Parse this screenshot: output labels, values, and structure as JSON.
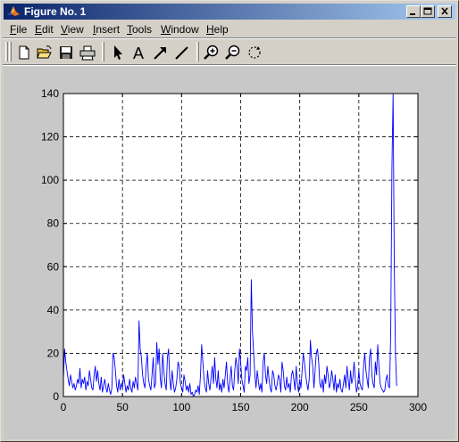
{
  "window": {
    "title": "Figure No. 1",
    "titlebar_gradient": [
      "#0a246a",
      "#a6caf0"
    ]
  },
  "menu": [
    "File",
    "Edit",
    "View",
    "Insert",
    "Tools",
    "Window",
    "Help"
  ],
  "menu_underlines": [
    "F",
    "E",
    "V",
    "I",
    "T",
    "W",
    "H"
  ],
  "toolbar": {
    "tools": [
      "new-file-icon",
      "open-folder-icon",
      "save-icon",
      "print-icon",
      "arrow-select-icon",
      "text-insert-icon",
      "arrow-insert-icon",
      "line-insert-icon",
      "zoom-in-icon",
      "zoom-out-icon",
      "rotate-icon"
    ],
    "text_tool_label": "A"
  },
  "chart_data": {
    "type": "line",
    "title": "",
    "xlabel": "",
    "ylabel": "",
    "xlim": [
      0,
      300
    ],
    "ylim": [
      0,
      140
    ],
    "grid": true,
    "x_ticks": [
      0,
      50,
      100,
      150,
      200,
      250,
      300
    ],
    "y_ticks": [
      0,
      20,
      40,
      60,
      80,
      100,
      120,
      140
    ],
    "series": [
      {
        "color": "#0000ff",
        "x_step": 1,
        "values": [
          8,
          22,
          16,
          12,
          8,
          5,
          10,
          7,
          4,
          6,
          3,
          5,
          8,
          6,
          13,
          4,
          8,
          6,
          9,
          3,
          7,
          5,
          12,
          8,
          4,
          3,
          10,
          14,
          7,
          12,
          6,
          3,
          9,
          2,
          5,
          8,
          4,
          2,
          6,
          3,
          1,
          4,
          20,
          18,
          12,
          5,
          2,
          8,
          3,
          6,
          4,
          10,
          6,
          2,
          5,
          3,
          8,
          4,
          2,
          7,
          4,
          9,
          6,
          3,
          35,
          22,
          18,
          10,
          6,
          4,
          14,
          20,
          8,
          5,
          3,
          10,
          18,
          4,
          6,
          25,
          15,
          22,
          8,
          4,
          20,
          12,
          6,
          3,
          18,
          22,
          8,
          3,
          12,
          6,
          2,
          4,
          8,
          16,
          14,
          6,
          4,
          2,
          10,
          7,
          3,
          5,
          2,
          6,
          1,
          2,
          0,
          1,
          3,
          2,
          5,
          1,
          10,
          24,
          16,
          8,
          4,
          2,
          12,
          6,
          3,
          9,
          14,
          6,
          18,
          8,
          4,
          12,
          3,
          6,
          2,
          8,
          4,
          10,
          16,
          6,
          2,
          8,
          14,
          5,
          3,
          12,
          18,
          14,
          6,
          22,
          16,
          8,
          5,
          2,
          14,
          12,
          18,
          6,
          10,
          54,
          30,
          20,
          10,
          4,
          12,
          7,
          3,
          6,
          2,
          16,
          20,
          10,
          6,
          14,
          8,
          4,
          2,
          12,
          10,
          5,
          3,
          6,
          10,
          8,
          2,
          16,
          12,
          5,
          3,
          9,
          4,
          6,
          2,
          10,
          12,
          8,
          3,
          14,
          6,
          2,
          8,
          4,
          12,
          20,
          16,
          10,
          6,
          3,
          8,
          26,
          18,
          14,
          4,
          12,
          20,
          22,
          16,
          6,
          4,
          8,
          2,
          10,
          6,
          14,
          10,
          4,
          6,
          12,
          8,
          3,
          10,
          2,
          6,
          4,
          8,
          3,
          2,
          6,
          10,
          4,
          14,
          8,
          3,
          12,
          6,
          9,
          16,
          8,
          2,
          5,
          12,
          6,
          4,
          3,
          14,
          20,
          12,
          8,
          4,
          18,
          22,
          10,
          6,
          4,
          16,
          10,
          24,
          14,
          6,
          4,
          3,
          2,
          3,
          8,
          10,
          5,
          4,
          30,
          105,
          140,
          60,
          20,
          5
        ]
      }
    ]
  }
}
